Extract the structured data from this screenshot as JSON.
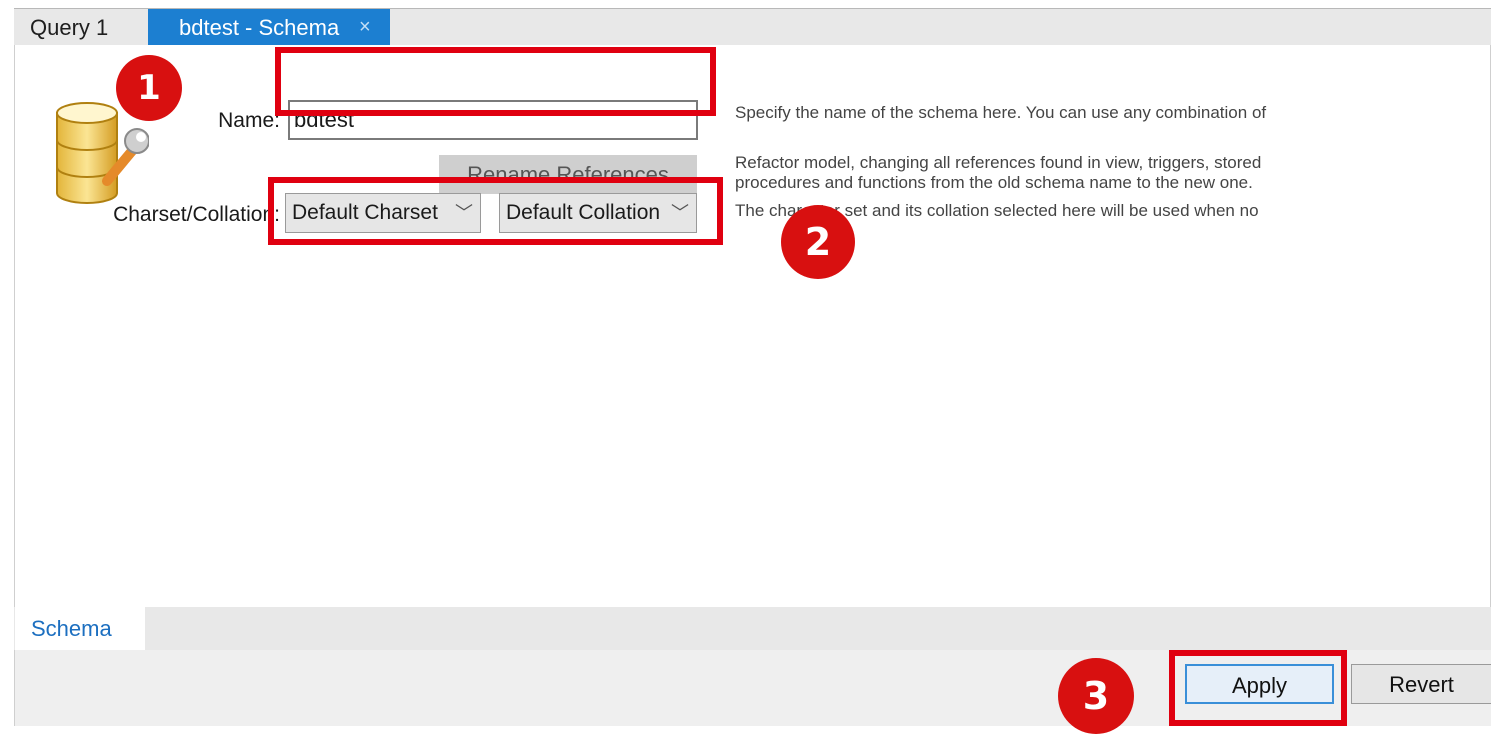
{
  "tabs": {
    "query_label": "Query 1",
    "schema_label": "bdtest - Schema",
    "close_glyph": "×"
  },
  "form": {
    "name_label": "Name:",
    "name_value": "bdtest",
    "rename_button": "Rename References",
    "charset_label": "Charset/Collation:",
    "charset_value": "Default Charset",
    "collation_value": "Default Collation",
    "chevron": "﹀"
  },
  "descriptions": {
    "name": "Specify the name of the schema here. You can use any combination of",
    "rename_line1": "Refactor model, changing all references found in view, triggers, stored",
    "rename_line2": "procedures and functions from the old schema name to the new one.",
    "charset": "The character set and its collation selected here will be used when no"
  },
  "annotations": {
    "step1": "1",
    "step2": "2",
    "step3": "3",
    "highlight_color": "#e00010",
    "badge_color": "#d81010"
  },
  "bottom_tabs": {
    "schema_label": "Schema"
  },
  "actions": {
    "apply_label": "Apply",
    "revert_label": "Revert"
  },
  "colors": {
    "accent": "#1c7fd1",
    "icon": "database-wrench-icon"
  }
}
